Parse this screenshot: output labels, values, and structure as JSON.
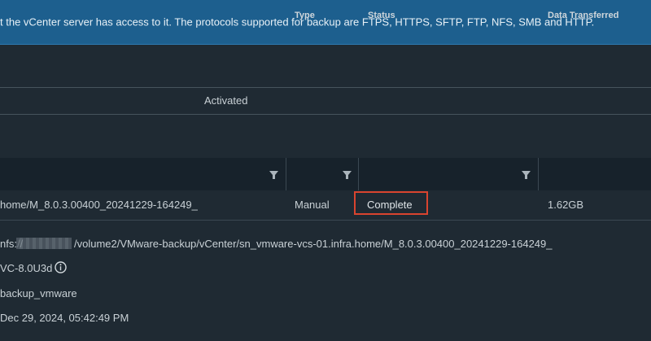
{
  "banner": {
    "text": "t the vCenter server has access to it. The protocols supported for backup are FTPS, HTTPS, SFTP, FTP, NFS, SMB and HTTP."
  },
  "schedule": {
    "status_value": "Activated"
  },
  "table": {
    "columns": [
      {
        "label": ""
      },
      {
        "label": "Type"
      },
      {
        "label": "Status"
      },
      {
        "label": "Data Transferred"
      }
    ],
    "row": {
      "location": "home/M_8.0.3.00400_20241229-164249_",
      "type": "Manual",
      "status": "Complete",
      "data_transferred": "1.62GB"
    }
  },
  "details": {
    "location_prefix": "nfs://",
    "location_suffix": "/volume2/VMware-backup/vCenter/sn_vmware-vcs-01.infra.home/M_8.0.3.00400_20241229-164249_",
    "version": "VC-8.0U3d",
    "user": "backup_vmware",
    "date": "Dec 29, 2024, 05:42:49 PM"
  },
  "icons": {
    "filter": "filter-icon",
    "info": "info-icon"
  },
  "colors": {
    "banner_bg": "#1d5f8e",
    "page_bg": "#1f2a33",
    "highlight": "#d9442f"
  }
}
